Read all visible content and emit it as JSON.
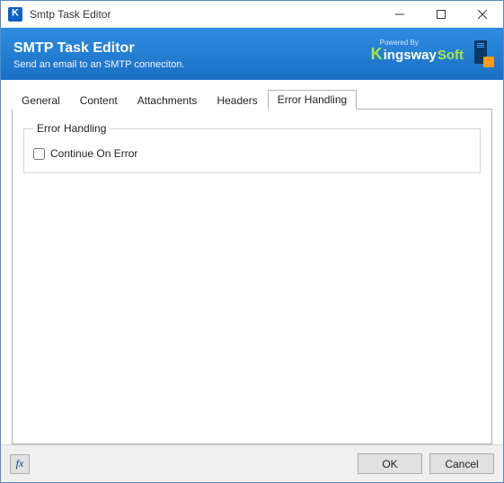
{
  "window": {
    "title": "Smtp Task Editor"
  },
  "header": {
    "title": "SMTP Task Editor",
    "subtitle": "Send an email to an SMTP conneciton.",
    "brand_powered": "Powered By",
    "brand_prefix": "K",
    "brand_mid": "ingsway",
    "brand_suffix": "Soft"
  },
  "tabs": [
    {
      "label": "General"
    },
    {
      "label": "Content"
    },
    {
      "label": "Attachments"
    },
    {
      "label": "Headers"
    },
    {
      "label": "Error Handling"
    }
  ],
  "active_tab_index": 4,
  "pane": {
    "group_title": "Error Handling",
    "checkbox_label": "Continue On Error",
    "checkbox_checked": false
  },
  "footer": {
    "fx_label": "fx",
    "ok": "OK",
    "cancel": "Cancel"
  }
}
